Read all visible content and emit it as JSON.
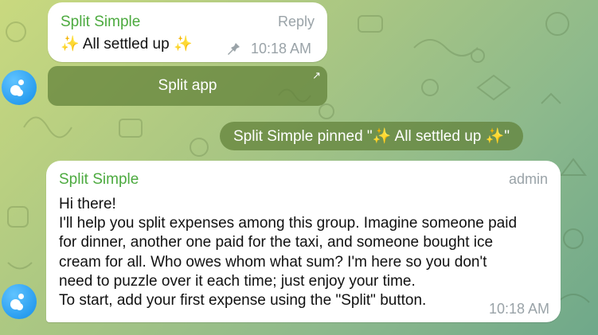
{
  "msg1": {
    "sender": "Split Simple",
    "reply_label": "Reply",
    "text": "✨ All settled up ✨",
    "time": "10:18 AM",
    "pin_icon": "pin-icon"
  },
  "inline_button": {
    "label": "Split app",
    "icon": "open-arrow-icon"
  },
  "service_message": {
    "text": "Split Simple pinned \"✨ All settled up ✨\""
  },
  "msg2": {
    "sender": "Split Simple",
    "role": "admin",
    "lines": [
      "Hi there!",
      "I'll help you split expenses among this group. Imagine someone paid",
      "for dinner, another one paid for the taxi, and someone bought ice",
      "cream for all. Who owes whom what sum? I'm here so you don't",
      "need to puzzle over it each time; just enjoy your time.",
      "To start, add your first expense using the \"Split\" button."
    ],
    "time": "10:18 AM"
  },
  "colors": {
    "sender": "#4caa3f",
    "meta": "#9aa3a8",
    "avatar": "#2a9ef0",
    "button_bg": "#5f8037"
  }
}
